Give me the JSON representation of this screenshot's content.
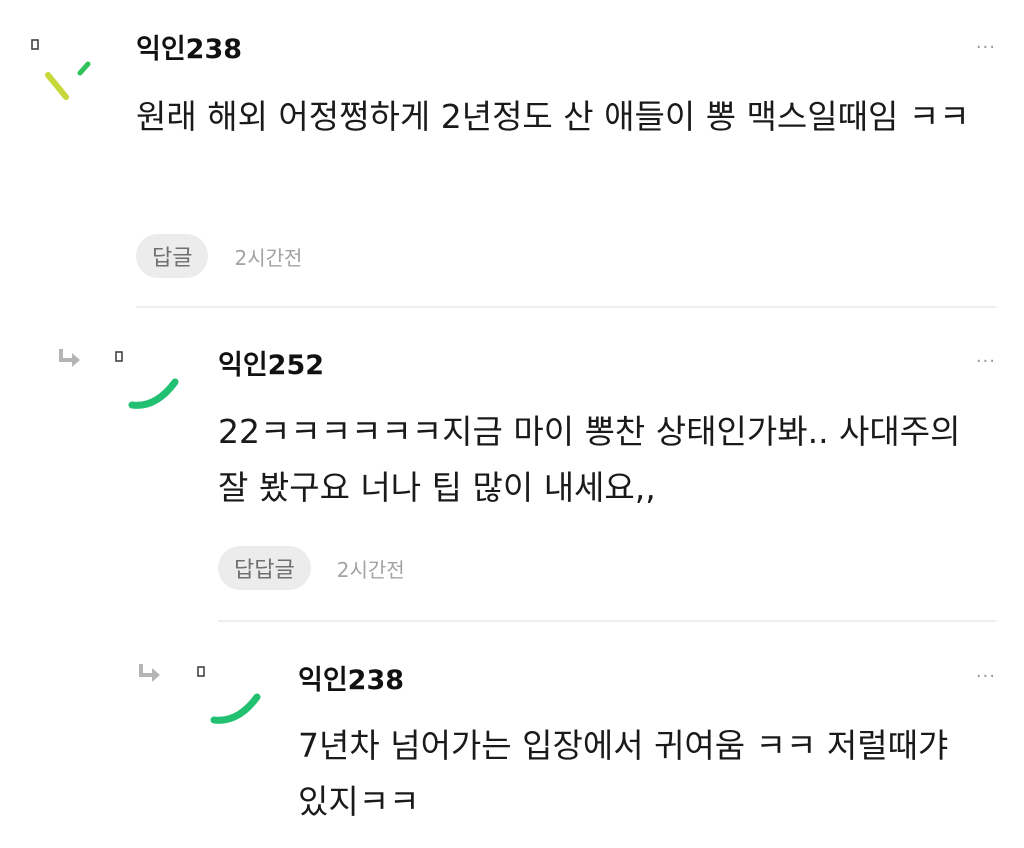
{
  "comments": [
    {
      "author": "익인238",
      "body": "원래 해외 어정쩡하게 2년정도 산 애들이 뽕 맥스일때임 ㅋㅋ",
      "reply_label": "답글",
      "time": "2시간전",
      "more": "···",
      "avatar_colors": [
        "#c6d83a",
        "#2fc15a"
      ]
    },
    {
      "author": "익인252",
      "body": "22ㅋㅋㅋㅋㅋㅋ지금 마이 뽕찬 상태인가봐.. 사대주의 잘 봤구요 너나 팁 많이 내세요,,",
      "reply_label": "답답글",
      "time": "2시간전",
      "more": "···",
      "avatar_colors": [
        "#22c172"
      ]
    },
    {
      "author": "익인238",
      "body": "7년차 넘어가는 입장에서 귀여움 ㅋㅋ 저럴때갸 있지ㅋㅋ",
      "more": "···",
      "avatar_colors": [
        "#22c172"
      ]
    }
  ]
}
